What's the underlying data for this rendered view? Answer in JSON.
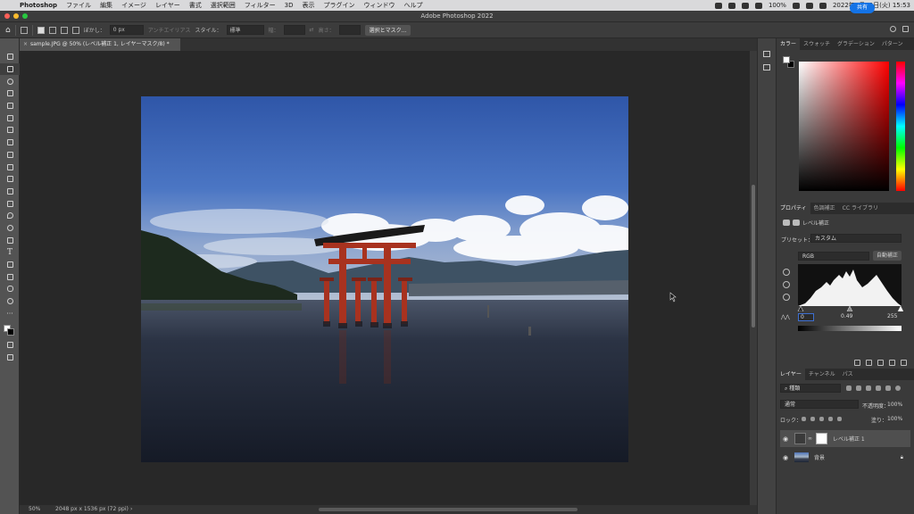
{
  "menubar": {
    "app_name": "Photoshop",
    "items": [
      "ファイル",
      "編集",
      "イメージ",
      "レイヤー",
      "書式",
      "選択範囲",
      "フィルター",
      "3D",
      "表示",
      "プラグイン",
      "ウィンドウ",
      "ヘルプ"
    ],
    "battery": "100%",
    "clock": "2022年5月10日(火) 15:53"
  },
  "window": {
    "title": "Adobe Photoshop 2022"
  },
  "options": {
    "feather_label": "ぼかし：",
    "feather_value": "0 px",
    "antialias_label": "アンチエイリアス",
    "style_label": "スタイル：",
    "style_value": "標準",
    "width_label": "幅：",
    "height_label": "高さ：",
    "select_mask_button": "選択とマスク...",
    "share_button": "共有"
  },
  "document": {
    "tab_title": "sample.JPG @ 50% (レベル補正 1, レイヤーマスク/8) *",
    "tab_close": "×"
  },
  "status": {
    "zoom": "50%",
    "dimensions": "2048 px x 1536 px (72 ppi)",
    "arrow": "›"
  },
  "color_panel": {
    "tabs": [
      "カラー",
      "スウォッチ",
      "グラデーション",
      "パターン"
    ]
  },
  "properties_panel": {
    "tabs": [
      "プロパティ",
      "色調補正",
      "CC ライブラリ"
    ],
    "adjustment_name": "レベル補正",
    "preset_label": "プリセット：",
    "preset_value": "カスタム",
    "channel_value": "RGB",
    "auto_button": "自動補正",
    "input_black": "0",
    "input_gamma": "0.49",
    "input_white": "255"
  },
  "layers_panel": {
    "tabs": [
      "レイヤー",
      "チャンネル",
      "パス"
    ],
    "filter_kind": "種類",
    "blend_mode": "通常",
    "opacity_label": "不透明度：",
    "opacity_value": "100%",
    "lock_label": "ロック：",
    "fill_label": "塗り：",
    "fill_value": "100%",
    "layers": [
      {
        "name": "レベル補正 1",
        "selected": true
      },
      {
        "name": "背景",
        "selected": false
      }
    ]
  }
}
